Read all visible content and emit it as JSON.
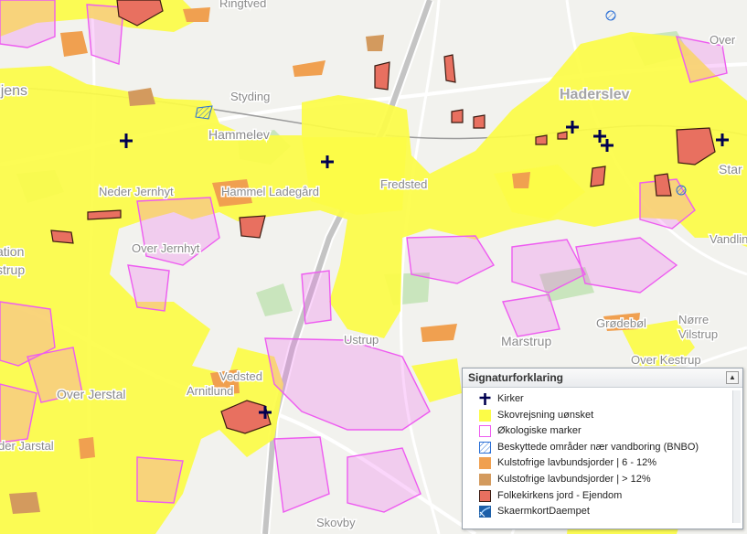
{
  "map": {
    "places": [
      {
        "key": "ringtved",
        "label": "Ringtved"
      },
      {
        "key": "over",
        "label": "Over"
      },
      {
        "key": "ojens",
        "label": "Vojens"
      },
      {
        "key": "styding",
        "label": "Styding"
      },
      {
        "key": "haderslev",
        "label": "Haderslev"
      },
      {
        "key": "hammelev",
        "label": "Hammelev"
      },
      {
        "key": "star",
        "label": "Star"
      },
      {
        "key": "nedjernhyt",
        "label": "Neder Jernhyt"
      },
      {
        "key": "hammellad",
        "label": "Hammel Ladegård"
      },
      {
        "key": "fredsted",
        "label": "Fredsted"
      },
      {
        "key": "ation",
        "label": "ation"
      },
      {
        "key": "strup",
        "label": "strup"
      },
      {
        "key": "overjernhyt",
        "label": "Over Jernhyt"
      },
      {
        "key": "vandlinq",
        "label": "Vandling"
      },
      {
        "key": "grodebol",
        "label": "Grødebøl"
      },
      {
        "key": "norre",
        "label": "Nørre"
      },
      {
        "key": "vilstrup",
        "label": "Vilstrup"
      },
      {
        "key": "marstrup",
        "label": "Marstrup"
      },
      {
        "key": "usto",
        "label": "Ustrup"
      },
      {
        "key": "vedsted",
        "label": "Vedsted"
      },
      {
        "key": "arnitlund",
        "label": "Arnitlund"
      },
      {
        "key": "overkestrup",
        "label": "Over Kestrup"
      },
      {
        "key": "overjerstal",
        "label": "Over Jerstal"
      },
      {
        "key": "nederjerstal",
        "label": "der Jarstal"
      },
      {
        "key": "skovby",
        "label": "Skovby"
      }
    ],
    "colors": {
      "background": "#f2f2ee",
      "forest": "#c9e5bd",
      "yellow": "#fcfc47",
      "ecology": "#ee5cf0",
      "low6": "#f0a050",
      "low12": "#d39a5e",
      "church_land": "#e87060",
      "church_cross": "#000050",
      "road": "#ffffff",
      "highway": "#b8b8b8"
    }
  },
  "legend": {
    "title": "Signaturforklaring",
    "toggle": "▲",
    "items": [
      {
        "label": "Kirker",
        "type": "cross"
      },
      {
        "label": "Skovrejsning uønsket",
        "type": "yellow"
      },
      {
        "label": "Økologiske marker",
        "type": "ecology"
      },
      {
        "label": "Beskyttede områder nær vandboring (BNBO)",
        "type": "hatch"
      },
      {
        "label": "Kulstofrige lavbundsjorder | 6 - 12%",
        "type": "low6"
      },
      {
        "label": "Kulstofrige lavbundsjorder | > 12%",
        "type": "low12"
      },
      {
        "label": "Folkekirkens jord - Ejendom",
        "type": "church"
      },
      {
        "label": "SkaermkortDaempet",
        "type": "basemap"
      }
    ]
  }
}
